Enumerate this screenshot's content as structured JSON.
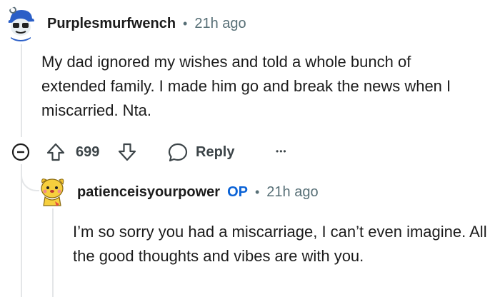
{
  "comment": {
    "username": "Purplesmurfwench",
    "separator": "•",
    "time": "21h ago",
    "body": "My dad ignored my wishes and told a whole bunch of extended family. I made him go and break the news when I miscarried. Nta.",
    "votes": "699",
    "reply_label": "Reply",
    "more_label": "•••"
  },
  "reply": {
    "username": "patienceisyourpower",
    "op_tag": "OP",
    "separator": "•",
    "time": "21h ago",
    "body": "I’m so sorry you had a miscarriage, I can’t even imagine. All the good thoughts and vibes are with you."
  },
  "icons": {
    "collapse": "collapse-icon",
    "upvote": "upvote-arrow-icon",
    "downvote": "downvote-arrow-icon",
    "reply": "speech-bubble-icon",
    "more": "more-options-icon"
  },
  "colors": {
    "text": "#1c1c1c",
    "meta": "#576f76",
    "op": "#0a62d6",
    "thread_line": "#e4e6e8"
  }
}
